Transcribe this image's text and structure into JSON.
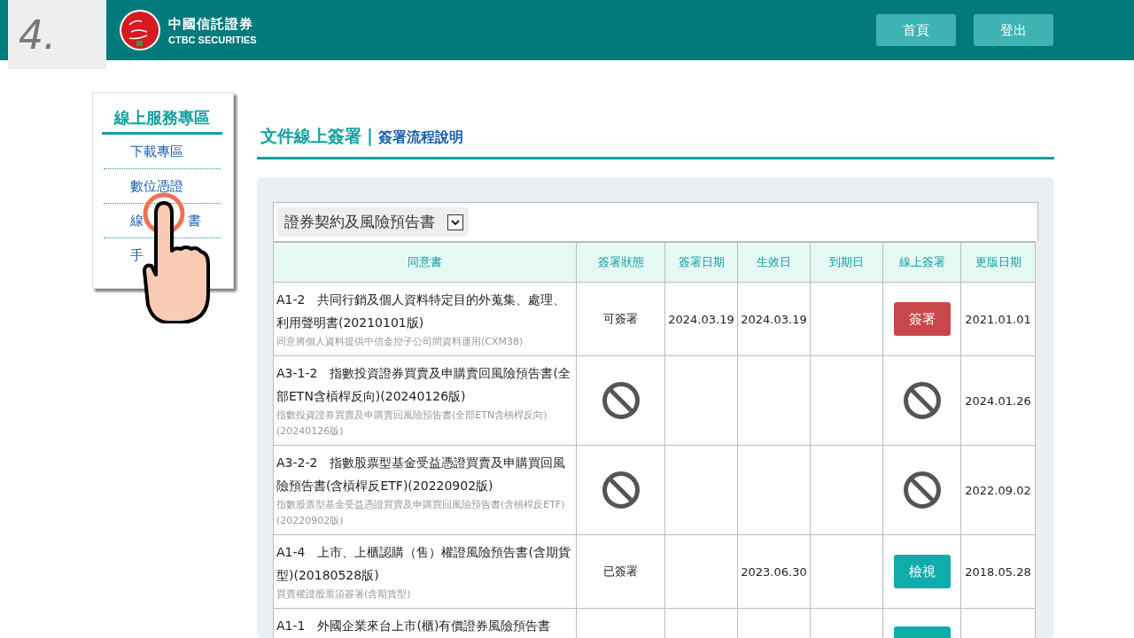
{
  "step_label": "4.",
  "header": {
    "brand_cn": "中國信託證券",
    "brand_en": "CTBC SECURITIES",
    "buttons": [
      "首頁",
      "登出"
    ]
  },
  "sidebar": {
    "title": "線上服務專區",
    "items": [
      {
        "parts": [
          "下載專區"
        ]
      },
      {
        "parts": [
          "數位憑證"
        ]
      },
      {
        "parts": [
          "線",
          "書"
        ]
      },
      {
        "parts": [
          "手"
        ]
      }
    ]
  },
  "page_title": "文件線上簽署",
  "title_separator": "|",
  "page_link": "簽署流程說明",
  "category_select": {
    "value": "證券契約及風險預告書"
  },
  "table": {
    "columns": [
      "同意書",
      "簽署狀態",
      "簽署日期",
      "生效日",
      "到期日",
      "線上簽署",
      "更版日期"
    ],
    "rows": [
      {
        "title": "A1-2　共同行銷及個人資料特定目的外蒐集、處理、利用聲明書(20210101版)",
        "note": "同意將個人資料提供中信金控子公司間資料運用(CXM38)",
        "status": {
          "kind": "text",
          "text": "可簽署"
        },
        "sign_date": "2024.03.19",
        "effective_date": "2024.03.19",
        "action": {
          "kind": "sign",
          "label": "簽署"
        },
        "revised": "2021.01.01"
      },
      {
        "title": "A3-1-2　指數投資證券買賣及申購賣回風險預告書(全部ETN含槓桿反向)(20240126版)",
        "note": "指數投資證券買賣及申購賣回風險預告書(全部ETN含槓桿反向)(20240126版)",
        "status": {
          "kind": "blocked"
        },
        "action": {
          "kind": "blocked"
        },
        "revised": "2024.01.26"
      },
      {
        "title": "A3-2-2　指數股票型基金受益憑證買賣及申購買回風險預告書(含槓桿反ETF)(20220902版)",
        "note": "指數股票型基金受益憑證買賣及申購買回風險預告書(含槓桿反ETF)(20220902版)",
        "status": {
          "kind": "blocked"
        },
        "action": {
          "kind": "blocked"
        },
        "revised": "2022.09.02"
      },
      {
        "title": "A1-4　上市、上櫃認購（售）權證風險預告書(含期貨型)(20180528版)",
        "note": "買賣權證股票須簽署(含期貨型)",
        "status": {
          "kind": "text",
          "text": "已簽署"
        },
        "effective_date": "2023.06.30",
        "action": {
          "kind": "view",
          "label": "檢視"
        },
        "revised": "2018.05.28"
      },
      {
        "title": "A1-1　外國企業來台上市(櫃)有價證券風險預告書",
        "action": {
          "kind": "view"
        }
      }
    ]
  }
}
